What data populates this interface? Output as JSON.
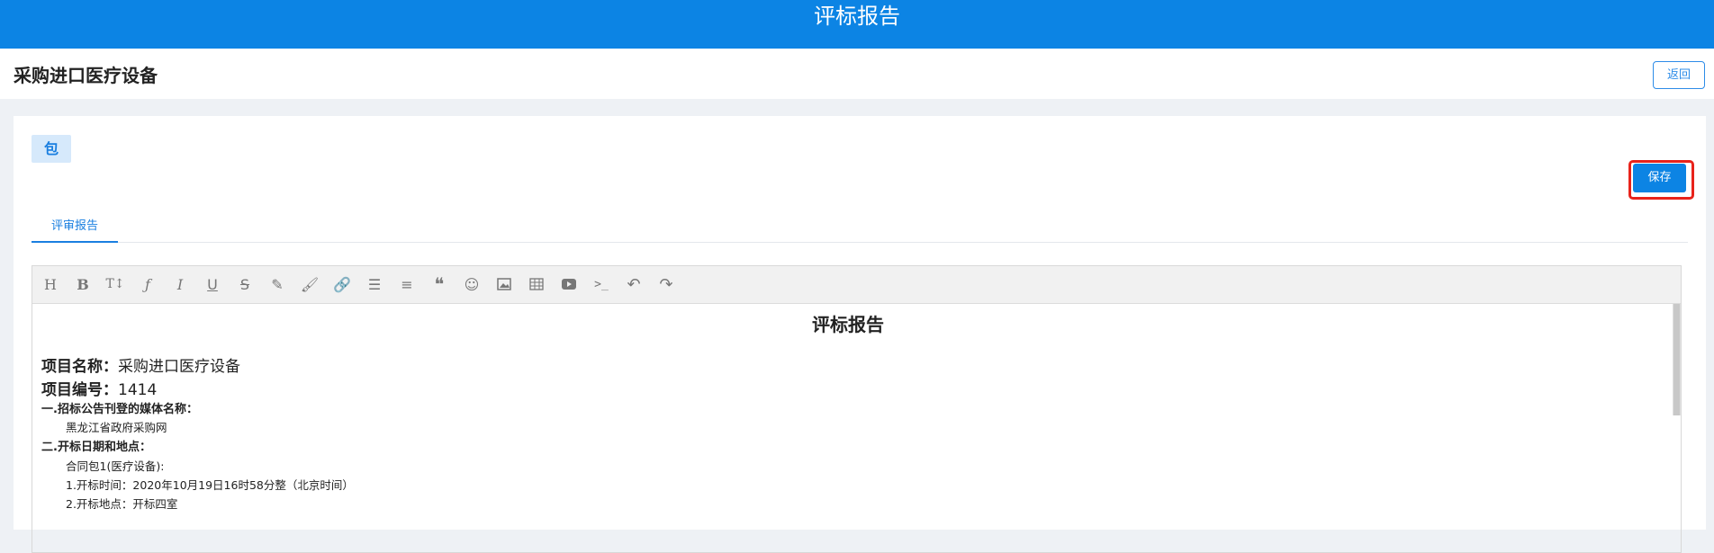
{
  "topbar": {
    "title": "评标报告"
  },
  "subheader": {
    "title": "采购进口医疗设备",
    "back_label": "返回"
  },
  "package": {
    "tag_label": "包"
  },
  "actions": {
    "save_label": "保存"
  },
  "tabs": [
    {
      "label": "评审报告",
      "active": true
    }
  ],
  "toolbar": {
    "icons": [
      "heading-icon",
      "bold-icon",
      "font-size-icon",
      "font-family-icon",
      "italic-icon",
      "underline-icon",
      "strikethrough-icon",
      "highlight-icon",
      "brush-icon",
      "link-icon",
      "bullet-list-icon",
      "align-icon",
      "quote-icon",
      "emoji-icon",
      "image-icon",
      "table-icon",
      "video-icon",
      "code-icon",
      "undo-icon",
      "redo-icon"
    ]
  },
  "document": {
    "title": "评标报告",
    "project_name_label": "项目名称：",
    "project_name_value": "采购进口医疗设备",
    "project_no_label": "项目编号：",
    "project_no_value": "1414",
    "section1_title": "一.招标公告刊登的媒体名称：",
    "section1_value": "黑龙江省政府采购网",
    "section2_title": "二.开标日期和地点：",
    "section2_package": "合同包1(医疗设备):",
    "section2_time": "1.开标时间：2020年10月19日16时58分整（北京时间）",
    "section2_place": "2.开标地点：开标四室"
  },
  "colors": {
    "primary": "#0c84e4",
    "highlight_box": "#e8231b"
  }
}
